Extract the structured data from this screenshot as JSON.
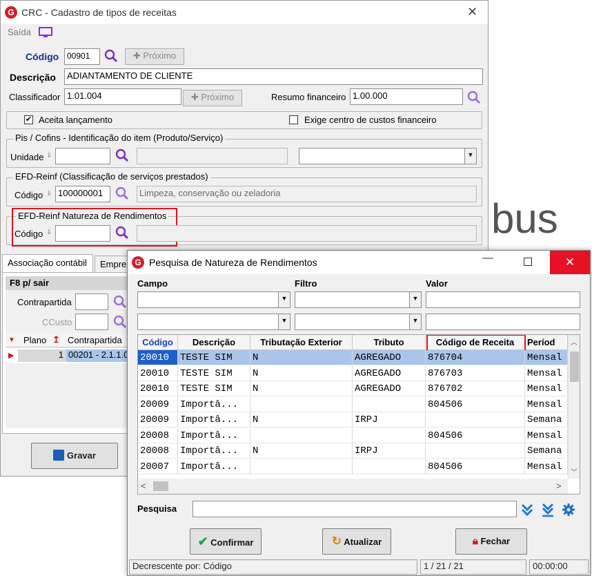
{
  "bg_fragment": "bus",
  "main_window": {
    "title": "CRC - Cadastro de tipos de receitas",
    "menu_exit": "Saída",
    "codigo_label": "Código",
    "codigo_value": "00901",
    "proximo_label": "Próximo",
    "descricao_label": "Descrição",
    "descricao_value": "ADIANTAMENTO DE CLIENTE",
    "classificador_label": "Classificador",
    "classificador_value": "1.01.004",
    "resumo_label": "Resumo financeiro",
    "resumo_value": "1.00.000",
    "aceita_label": "Aceita lançamento",
    "aceita_checked": true,
    "exige_label": "Exige centro de custos financeiro",
    "exige_checked": false,
    "pis_group_title": "Pis / Cofins - Identificação do item (Produto/Serviço)",
    "unidade_label": "Unidade",
    "efd_group_title": "EFD-Reinf (Classificação de serviços prestados)",
    "efd_codigo_label": "Código",
    "efd_codigo_value": "100000001",
    "efd_desc_value": "Limpeza, conservação ou zeladoria",
    "nat_group_title": "EFD-Reinf Natureza de Rendimentos",
    "nat_codigo_label": "Código",
    "tabs": [
      "Associação contábil",
      "Empre"
    ],
    "f8_label": "F8 p/ sair",
    "contrapartida_label": "Contrapartida",
    "ccusto_label": "CCusto",
    "grid_headers": [
      "Plano",
      "Contrapartida"
    ],
    "grid_row": {
      "plano": "1",
      "contrapartida": "00201 - 2.1.1.0"
    },
    "gravar_label": "Gravar"
  },
  "search_dialog": {
    "title": "Pesquisa de Natureza de Rendimentos",
    "campo_label": "Campo",
    "filtro_label": "Filtro",
    "valor_label": "Valor",
    "columns": [
      "Código",
      "Descrição",
      "Tributação Exterior",
      "Tributo",
      "Código de Receita",
      "Períod"
    ],
    "rows": [
      [
        "20010",
        "TESTE SIM",
        "N",
        "AGREGADO",
        "876704",
        "Mensal"
      ],
      [
        "20010",
        "TESTE SIM",
        "N",
        "AGREGADO",
        "876703",
        "Mensal"
      ],
      [
        "20010",
        "TESTE SIM",
        "N",
        "AGREGADO",
        "876702",
        "Mensal"
      ],
      [
        "20009",
        "Importâ...",
        "",
        "",
        "804506",
        "Mensal"
      ],
      [
        "20009",
        "Importâ...",
        "N",
        "IRPJ",
        "",
        "Semana"
      ],
      [
        "20008",
        "Importâ...",
        "",
        "",
        "804506",
        "Mensal"
      ],
      [
        "20008",
        "Importâ...",
        "N",
        "IRPJ",
        "",
        "Semana"
      ],
      [
        "20007",
        "Importâ...",
        "",
        "",
        "804506",
        "Mensal"
      ]
    ],
    "pesquisa_label": "Pesquisa",
    "confirmar_label": "Confirmar",
    "atualizar_label": "Atualizar",
    "fechar_label": "Fechar",
    "status_sort": "Decrescente por: Código",
    "status_count": "1 / 21 / 21",
    "status_time": "00:00:00"
  },
  "colors": {
    "accent_red": "#e0141e",
    "selection": "#a9c6ea",
    "magnifier": "#7b2fbe",
    "brand_blue": "#1a5fb4"
  }
}
